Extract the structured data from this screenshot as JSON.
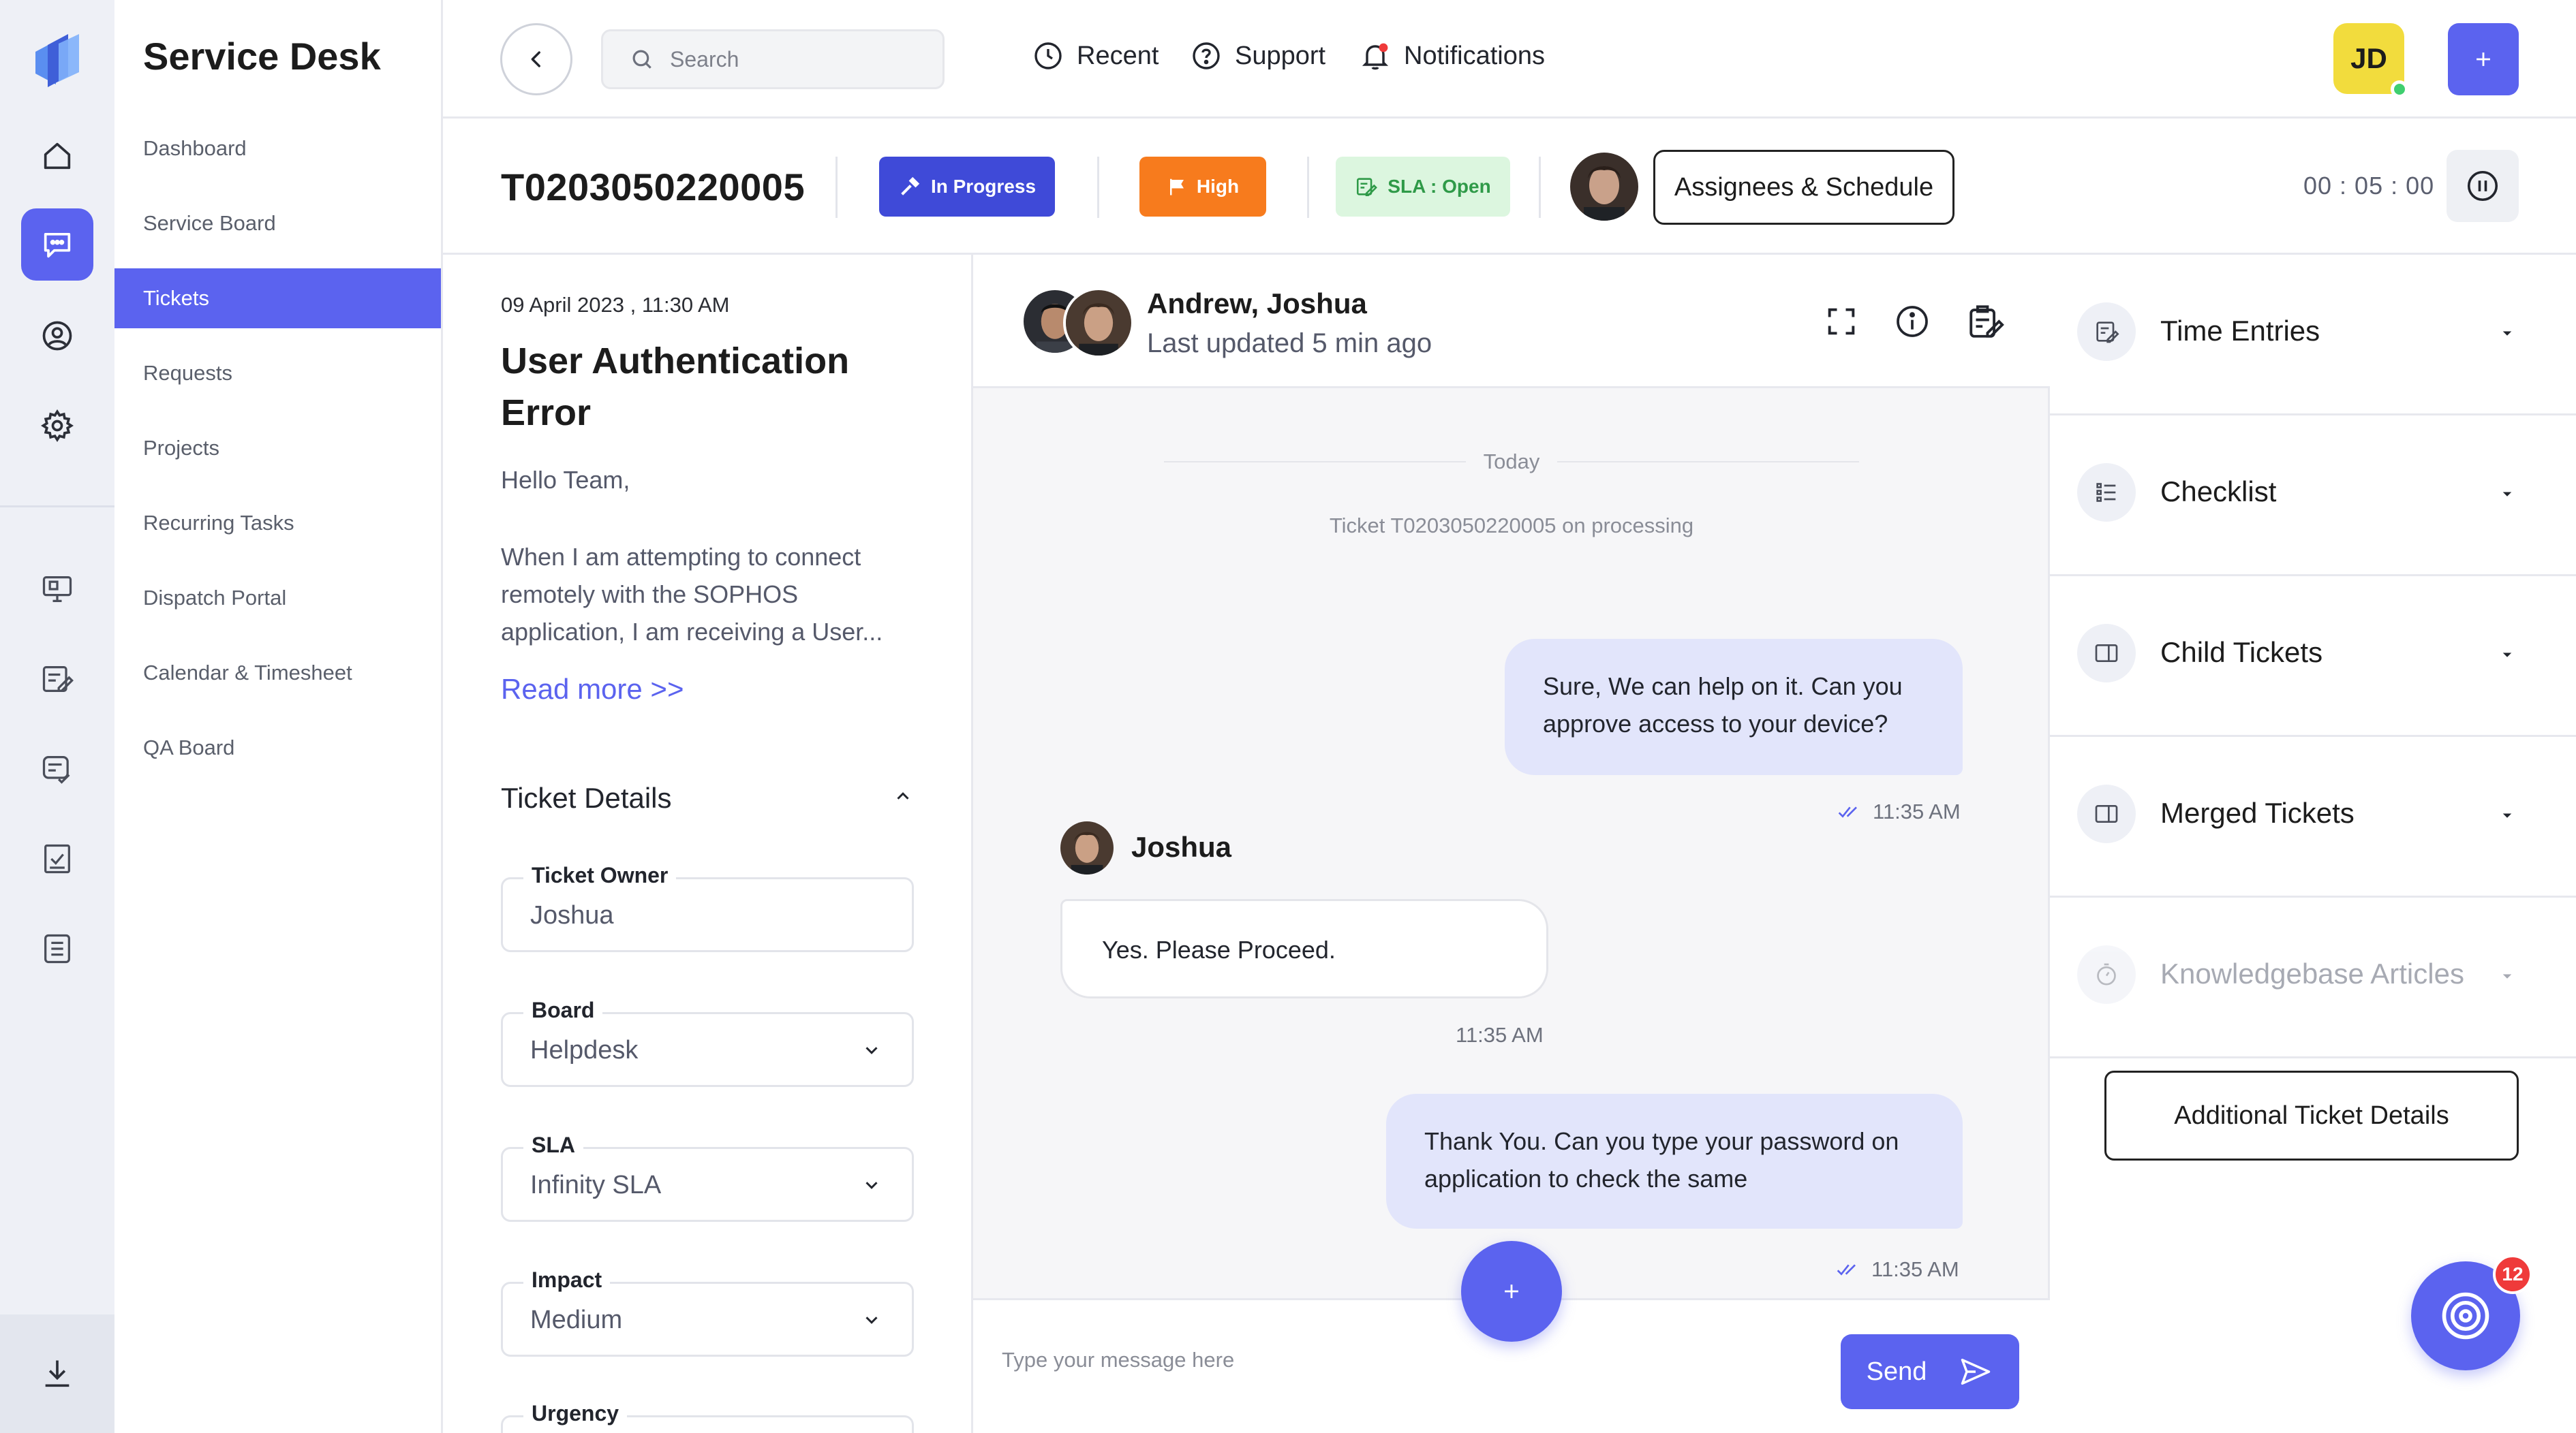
{
  "app": {
    "title": "Service Desk"
  },
  "nav": {
    "items": [
      {
        "label": "Dashboard"
      },
      {
        "label": "Service Board"
      },
      {
        "label": "Tickets"
      },
      {
        "label": "Requests"
      },
      {
        "label": "Projects"
      },
      {
        "label": "Recurring Tasks"
      },
      {
        "label": "Dispatch Portal"
      },
      {
        "label": "Calendar & Timesheet"
      },
      {
        "label": "QA Board"
      }
    ],
    "active": "Tickets"
  },
  "topbar": {
    "search_placeholder": "Search",
    "recent": "Recent",
    "support": "Support",
    "notifications": "Notifications",
    "user_initials": "JD"
  },
  "ticket": {
    "id": "T0203050220005",
    "status": "In Progress",
    "priority": "High",
    "sla": "SLA : Open",
    "assign_button": "Assignees & Schedule",
    "timer": "00 : 05 : 00",
    "date": "09 April 2023 , 11:30 AM",
    "subject": "User Authentication Error",
    "greeting": "Hello Team,",
    "body": "When I am attempting to connect remotely with the SOPHOS application, I am receiving a User...",
    "read_more": "Read more >>",
    "details_title": "Ticket Details",
    "fields": [
      {
        "label": "Ticket Owner",
        "value": "Joshua"
      },
      {
        "label": "Board",
        "value": "Helpdesk"
      },
      {
        "label": "SLA",
        "value": "Infinity SLA"
      },
      {
        "label": "Impact",
        "value": "Medium"
      },
      {
        "label": "Urgency",
        "value": ""
      }
    ]
  },
  "chat": {
    "participants": "Andrew, Joshua",
    "last_updated": "Last updated  5 min ago",
    "day_divider": "Today",
    "system_message": "Ticket T0203050220005 on processing",
    "messages": [
      {
        "text": "Sure, We can help on it. Can you approve access to your device?",
        "time": "11:35 AM",
        "direction": "out"
      },
      {
        "sender": "Joshua",
        "text": "Yes. Please Proceed.",
        "time": "11:35 AM",
        "direction": "in"
      },
      {
        "text": "Thank You. Can you type your password on application to check the same",
        "time": "11:35 AM",
        "direction": "out"
      }
    ],
    "compose_placeholder": "Type your message here",
    "send_label": "Send"
  },
  "side": {
    "sections": [
      {
        "label": "Time Entries",
        "icon": "time-entries-icon"
      },
      {
        "label": "Checklist",
        "icon": "checklist-icon"
      },
      {
        "label": "Child Tickets",
        "icon": "child-tickets-icon"
      },
      {
        "label": "Merged Tickets",
        "icon": "merged-tickets-icon"
      },
      {
        "label": "Knowledgebase Articles",
        "icon": "stopwatch-icon",
        "disabled": true
      }
    ],
    "additional_button": "Additional Ticket Details",
    "badge_count": "12"
  },
  "colors": {
    "accent": "#5b63ef",
    "status_in_progress": "#3f4ad8",
    "priority_high": "#f77b1d",
    "sla_open_bg": "#dcf6df",
    "sla_open_text": "#2f9a48",
    "avatar_bg": "#f2dc3d",
    "online": "#3fcf6f",
    "badge": "#ef3a3a"
  }
}
